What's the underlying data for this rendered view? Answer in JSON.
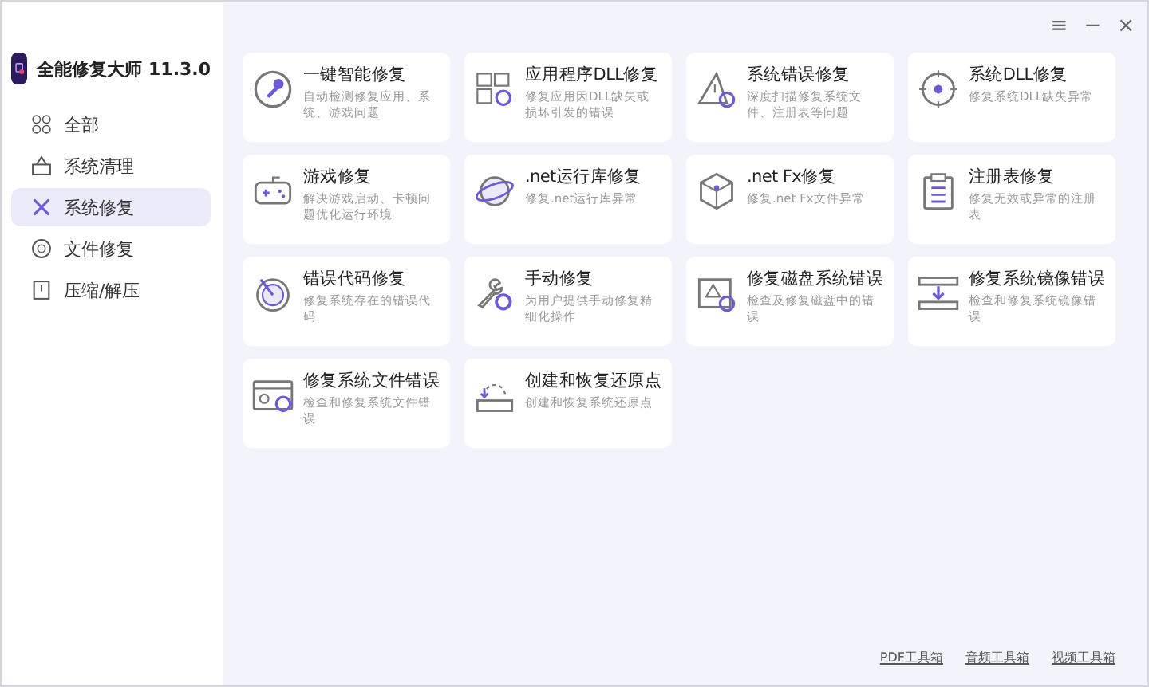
{
  "window": {
    "title": "全能修复大师 11.3.0",
    "controls": [
      "≡",
      "−",
      "×"
    ]
  },
  "sidebar": {
    "items": [
      {
        "label": "全部",
        "selected": false
      },
      {
        "label": "系统清理",
        "selected": false
      },
      {
        "label": "系统修复",
        "selected": true
      },
      {
        "label": "文件修复",
        "selected": false
      },
      {
        "label": "压缩/解压",
        "selected": false
      }
    ]
  },
  "cards": [
    {
      "title": "一键智能修复",
      "description": "自动检测修复应用、系统、游戏问题"
    },
    {
      "title": "应用程序DLL修复",
      "description": "修复应用因DLL缺失或损坏引发的错误"
    },
    {
      "title": "系统错误修复",
      "description": "深度扫描修复系统文件、注册表等问题"
    },
    {
      "title": "系统DLL修复",
      "description": "修复系统DLL缺失异常"
    },
    {
      "title": "游戏修复",
      "description": "解决游戏启动、卡顿问题优化运行环境"
    },
    {
      "title": ".net运行库修复",
      "description": "修复.net运行库异常"
    },
    {
      "title": ".net Fx修复",
      "description": "修复.net Fx文件异常"
    },
    {
      "title": "注册表修复",
      "description": "修复无效或异常的注册表"
    },
    {
      "title": "错误代码修复",
      "description": "修复系统存在的错误代码"
    },
    {
      "title": "手动修复",
      "description": "为用户提供手动修复精细化操作"
    },
    {
      "title": "修复磁盘系统错误",
      "description": "检查及修复磁盘中的错误"
    },
    {
      "title": "修复系统镜像错误",
      "description": "检查和修复系统镜像错误"
    },
    {
      "title": "修复系统文件错误",
      "description": "检查和修复系统文件错误"
    },
    {
      "title": "创建和恢复还原点",
      "description": "创建和恢复系统还原点"
    }
  ],
  "footer_links": [
    "PDF工具箱",
    "音频工具箱",
    "视频工具箱"
  ]
}
